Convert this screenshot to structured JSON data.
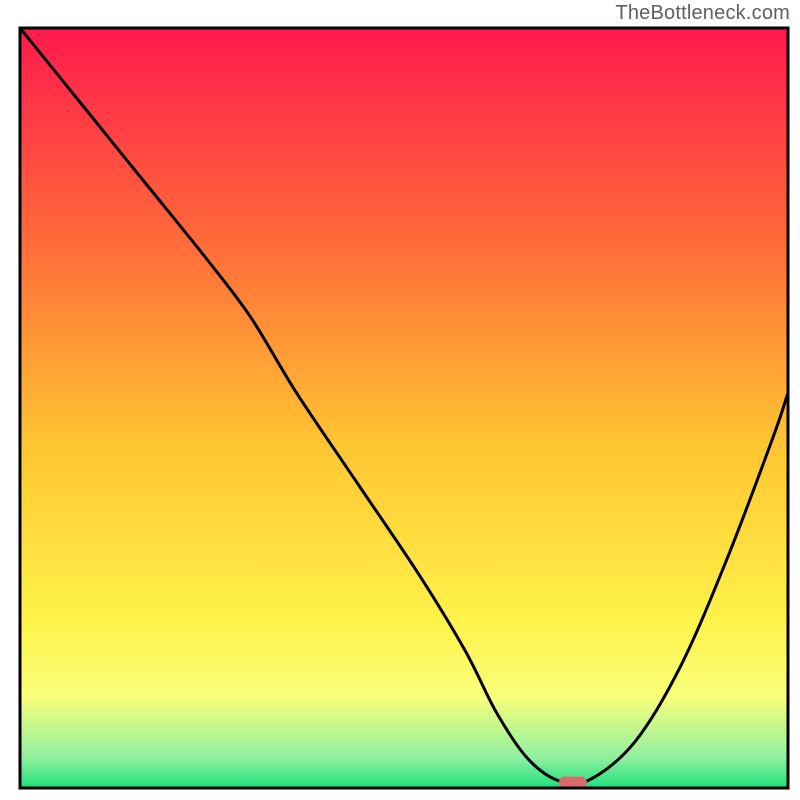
{
  "attribution": "TheBottleneck.com",
  "chart_data": {
    "type": "line",
    "title": "",
    "xlabel": "",
    "ylabel": "",
    "xlim": [
      0,
      100
    ],
    "ylim": [
      0,
      100
    ],
    "background": {
      "type": "vertical-gradient",
      "stops": [
        {
          "pos": 0.0,
          "color": "#ff1a4d"
        },
        {
          "pos": 0.28,
          "color": "#ff6a3a"
        },
        {
          "pos": 0.55,
          "color": "#ffc632"
        },
        {
          "pos": 0.78,
          "color": "#fff24a"
        },
        {
          "pos": 0.88,
          "color": "#f9ff7a"
        },
        {
          "pos": 0.96,
          "color": "#8ff0a0"
        },
        {
          "pos": 1.0,
          "color": "#1fe07a"
        }
      ]
    },
    "series": [
      {
        "name": "bottleneck-curve",
        "x": [
          0,
          8,
          16,
          24,
          30,
          36,
          44,
          52,
          58,
          62,
          66,
          70,
          74,
          80,
          86,
          92,
          98,
          100
        ],
        "y": [
          100,
          90,
          80,
          70,
          62,
          52,
          40,
          28,
          18,
          10,
          4,
          1,
          1,
          6,
          16,
          30,
          46,
          52
        ]
      }
    ],
    "marker": {
      "name": "optimal-point",
      "x": 72,
      "y": 0.7,
      "color": "#d86a6a",
      "shape": "rounded-rect"
    },
    "axes": {
      "show_ticks": false,
      "show_grid": false,
      "frame": true,
      "frame_color": "#000000",
      "frame_width": 3
    }
  }
}
